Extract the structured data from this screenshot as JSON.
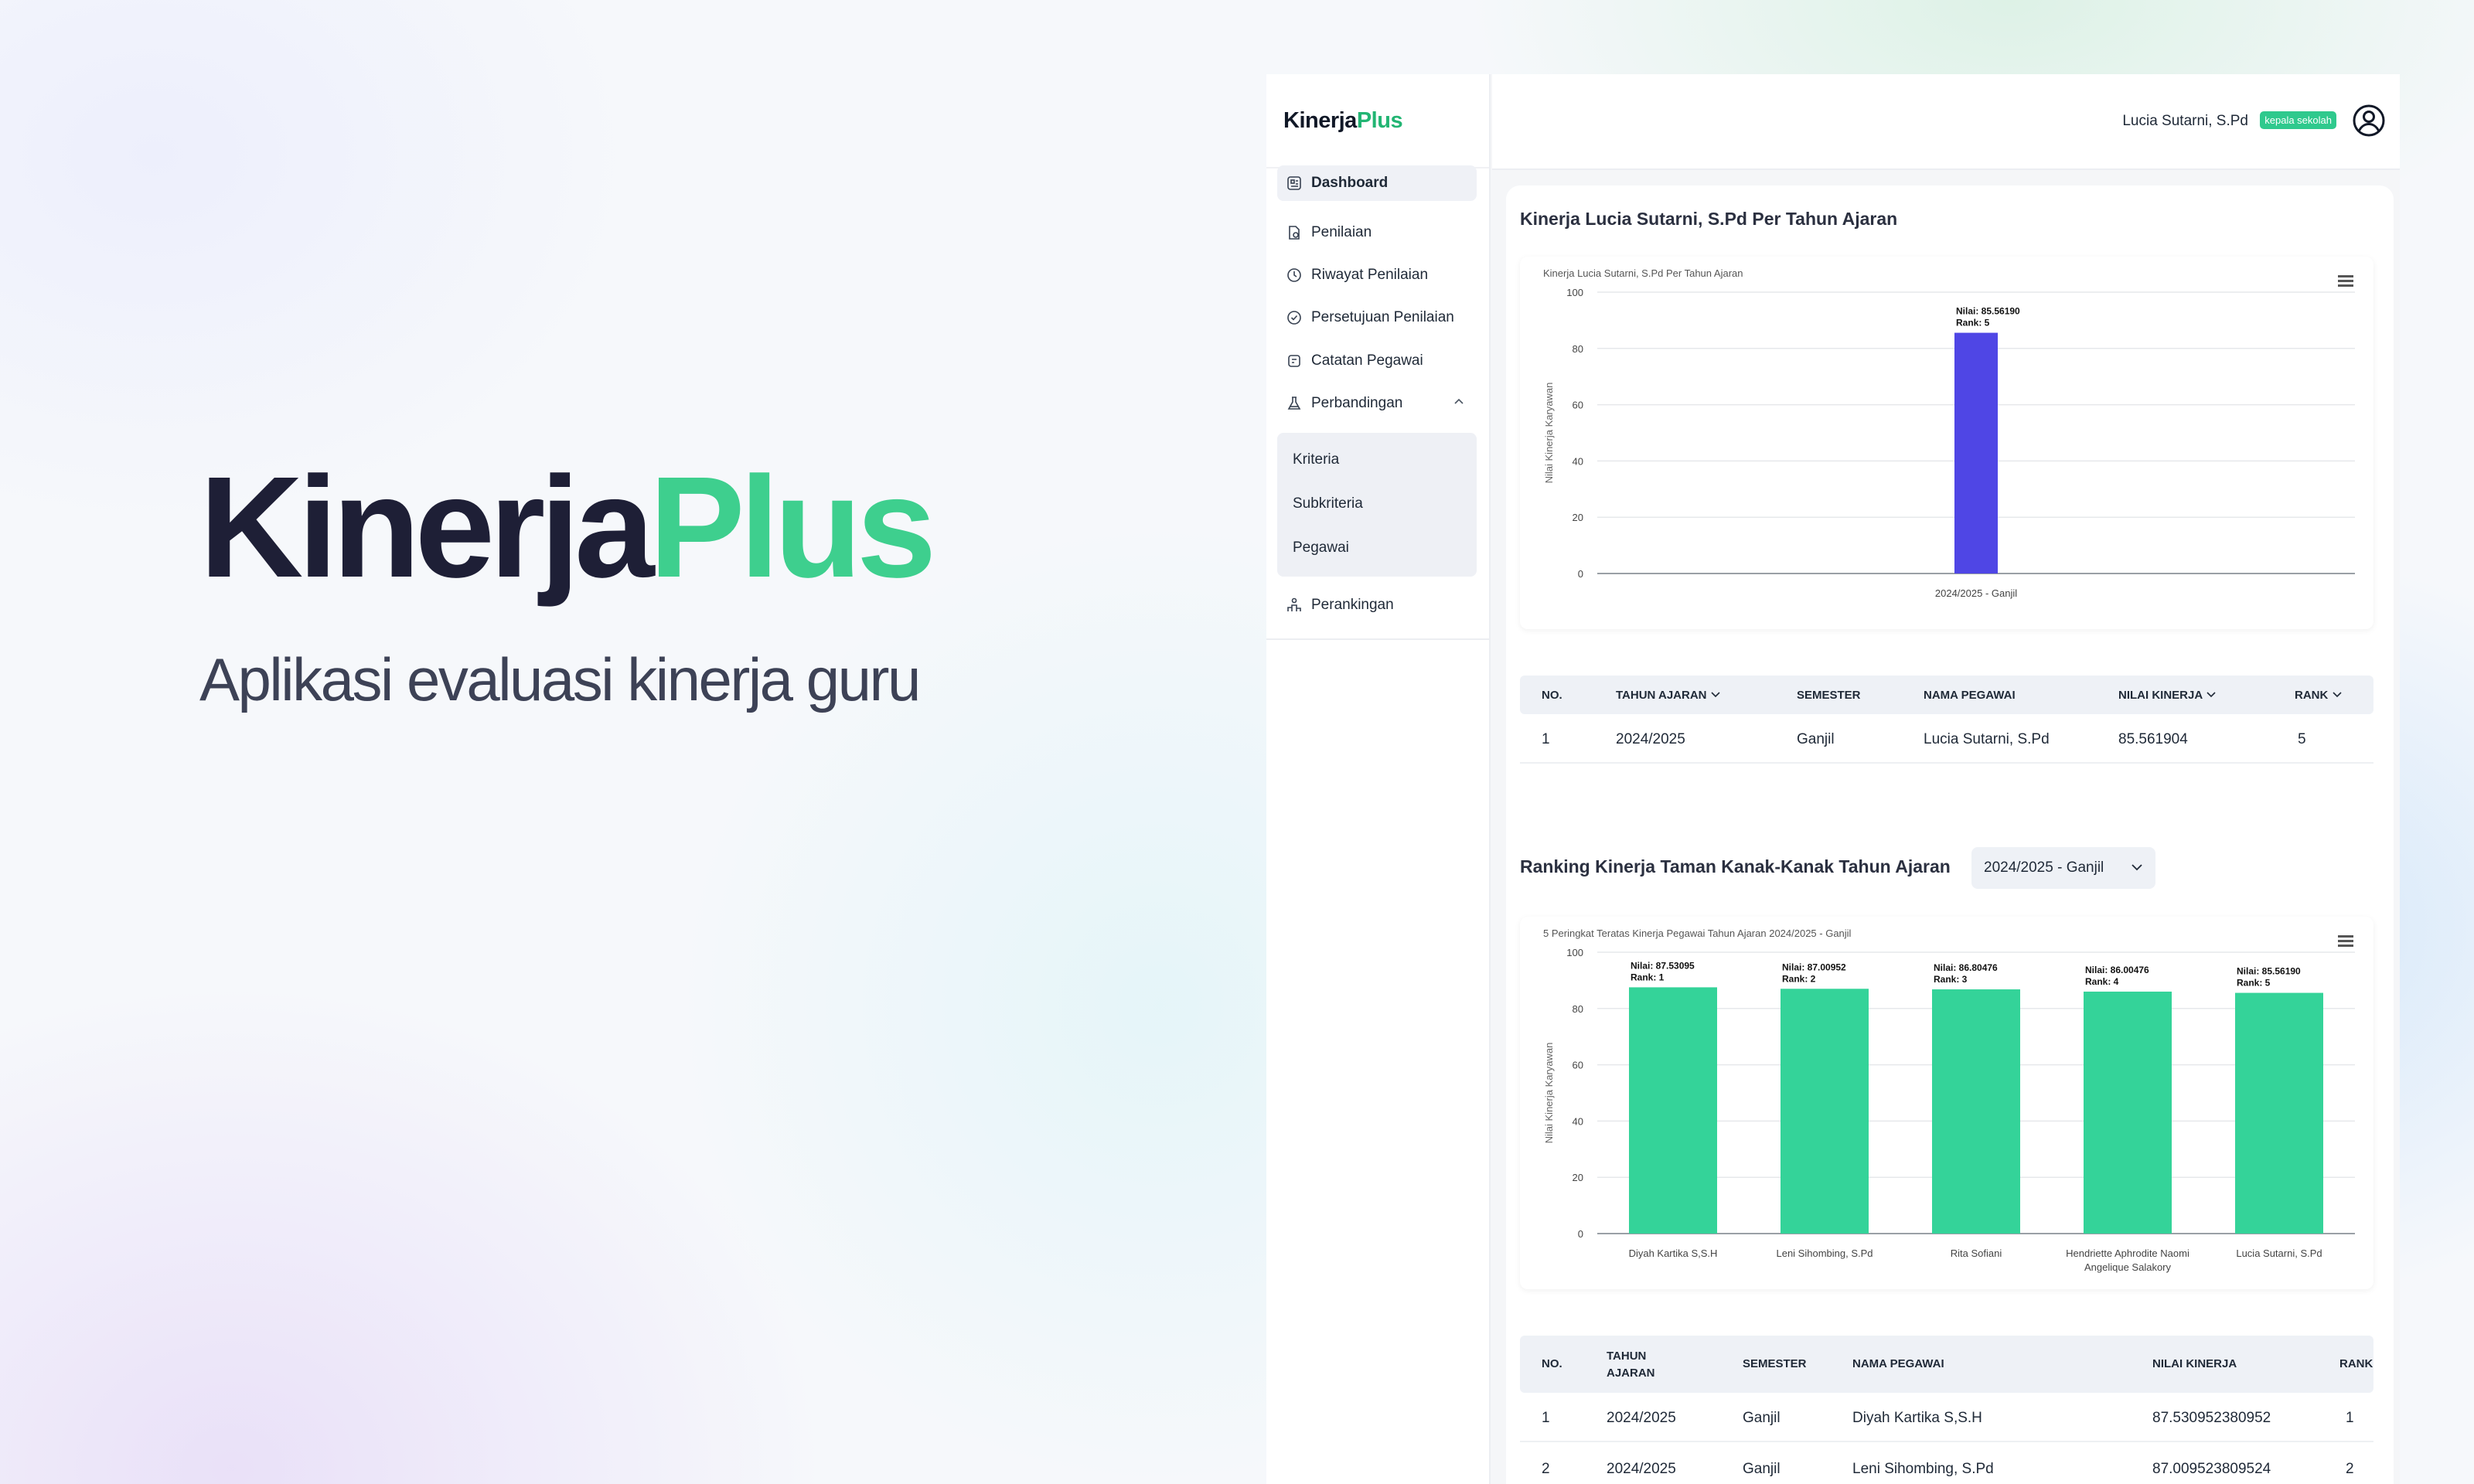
{
  "hero": {
    "brand_part1": "Kinerja",
    "brand_part2": "Plus",
    "subtitle": "Aplikasi evaluasi kinerja guru"
  },
  "colors": {
    "brand_green": "#3ecf8e",
    "bar_blue": "#4f46e5",
    "bar_green": "#34d399",
    "badge_green": "#2fc98d"
  },
  "app": {
    "brand_part1": "Kinerja",
    "brand_part2": "Plus",
    "user": {
      "name": "Lucia Sutarni, S.Pd",
      "role": "kepala sekolah",
      "icon": "user-circle-icon"
    },
    "nav": [
      {
        "label": "Dashboard",
        "icon": "dashboard-icon"
      },
      {
        "label": "Penilaian",
        "icon": "document-chart-icon"
      },
      {
        "label": "Riwayat Penilaian",
        "icon": "clock-icon"
      },
      {
        "label": "Persetujuan Penilaian",
        "icon": "check-circle-icon"
      },
      {
        "label": "Catatan Pegawai",
        "icon": "note-icon"
      },
      {
        "label": "Perbandingan",
        "icon": "flask-icon"
      },
      {
        "label": "Perankingan",
        "icon": "ranking-icon"
      }
    ],
    "subnav": [
      "Kriteria",
      "Subkriteria",
      "Pegawai"
    ]
  },
  "section1": {
    "title": "Kinerja Lucia Sutarni, S.Pd Per Tahun Ajaran",
    "table": {
      "headers": [
        "NO.",
        "TAHUN AJARAN",
        "SEMESTER",
        "NAMA PEGAWAI",
        "NILAI KINERJA",
        "RANK"
      ],
      "rows": [
        [
          "1",
          "2024/2025",
          "Ganjil",
          "Lucia Sutarni, S.Pd",
          "85.561904",
          "5"
        ]
      ]
    }
  },
  "section2": {
    "title": "Ranking Kinerja Taman Kanak-Kanak Tahun Ajaran",
    "select_value": "2024/2025 - Ganjil",
    "table": {
      "headers": [
        "NO.",
        "TAHUN AJARAN",
        "SEMESTER",
        "NAMA PEGAWAI",
        "NILAI KINERJA",
        "RANK"
      ],
      "rows": [
        [
          "1",
          "2024/2025",
          "Ganjil",
          "Diyah Kartika S,S.H",
          "87.530952380952",
          "1"
        ],
        [
          "2",
          "2024/2025",
          "Ganjil",
          "Leni Sihombing, S.Pd",
          "87.009523809524",
          "2"
        ]
      ]
    }
  },
  "chart_data": [
    {
      "type": "bar",
      "title": "Kinerja Lucia Sutarni, S.Pd Per Tahun Ajaran",
      "ylabel": "Nilai Kinerja Karyawan",
      "categories": [
        "2024/2025 - Ganjil"
      ],
      "values": [
        85.5619
      ],
      "data_labels": [
        [
          "Nilai: 85.56190",
          "Rank: 5"
        ]
      ],
      "ylim": [
        0,
        100
      ],
      "yticks": [
        "0",
        "20",
        "40",
        "60",
        "80",
        "100"
      ],
      "grid": true
    },
    {
      "type": "bar",
      "title": "5 Peringkat Teratas Kinerja Pegawai Tahun Ajaran 2024/2025 - Ganjil",
      "ylabel": "Nilai Kinerja Karyawan",
      "categories": [
        [
          "Diyah Kartika S,S.H"
        ],
        [
          "Leni Sihombing, S.Pd"
        ],
        [
          "Rita Sofiani"
        ],
        [
          "Hendriette Aphrodite Naomi",
          "Angelique Salakory"
        ],
        [
          "Lucia Sutarni, S.Pd"
        ]
      ],
      "values": [
        87.53095,
        87.00952,
        86.80476,
        86.00476,
        85.5619
      ],
      "data_labels": [
        [
          "Nilai: 87.53095",
          "Rank: 1"
        ],
        [
          "Nilai: 87.00952",
          "Rank: 2"
        ],
        [
          "Nilai: 86.80476",
          "Rank: 3"
        ],
        [
          "Nilai: 86.00476",
          "Rank: 4"
        ],
        [
          "Nilai: 85.56190",
          "Rank: 5"
        ]
      ],
      "ylim": [
        0,
        100
      ],
      "yticks": [
        "0",
        "20",
        "40",
        "60",
        "80",
        "100"
      ],
      "grid": true
    }
  ]
}
